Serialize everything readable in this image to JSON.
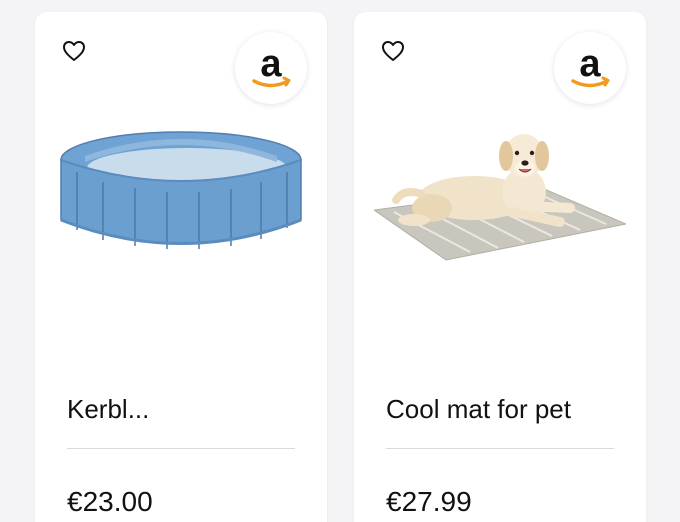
{
  "colors": {
    "background": "#f4f4f6",
    "card": "#ffffff",
    "amazon_arrow": "#f29a1f",
    "divider": "#d9d9de"
  },
  "products": [
    {
      "title": "Kerbl...",
      "price": "€23.00",
      "store": {
        "logo_letter": "a",
        "icon": "amazon-logo-icon"
      },
      "favorite_icon": "heart-outline-icon",
      "image": "blue-pet-pool-image"
    },
    {
      "title": "Cool mat for pet",
      "price": "€27.99",
      "store": {
        "logo_letter": "a",
        "icon": "amazon-logo-icon"
      },
      "favorite_icon": "heart-outline-icon",
      "image": "dog-on-cooling-mat-image"
    }
  ]
}
